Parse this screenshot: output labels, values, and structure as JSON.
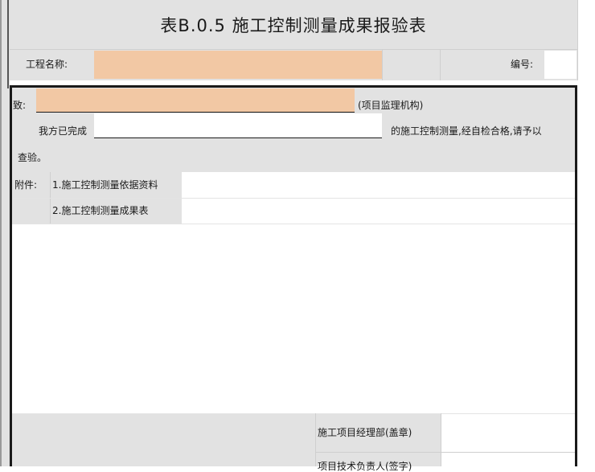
{
  "form": {
    "title": "表B.0.5 施工控制测量成果报验表",
    "project_name_label": "工程名称:",
    "project_name_value": "",
    "number_label": "编号:",
    "number_value": "",
    "to_label": "致:",
    "to_value": "",
    "to_suffix": "(项目监理机构)",
    "completed_prefix": "我方已完成",
    "completed_value": "",
    "completed_suffix": "的施工控制测量,经自检合格,请予以",
    "inspect_text": "查验。",
    "attachments_label": "附件:",
    "attachment_1": "1.施工控制测量依据资料",
    "attachment_2": "2.施工控制测量成果表",
    "sign_dept_label": "施工项目经理部(盖章)",
    "sign_person_label": "项目技术负责人(签字)"
  }
}
